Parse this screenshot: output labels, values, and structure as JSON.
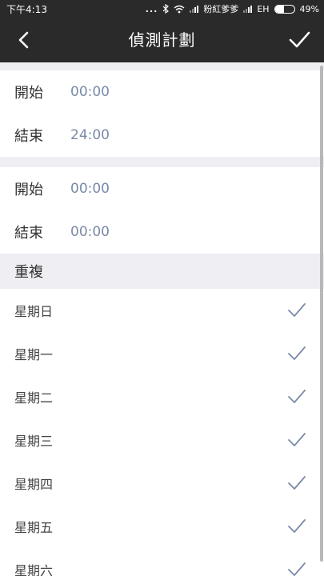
{
  "status_bar": {
    "time": "下午4:13",
    "dots": "...",
    "carrier": "粉紅爹爹",
    "network": "EH",
    "battery": "49%",
    "battery_level": 0.49
  },
  "nav": {
    "title": "偵測計劃",
    "back_icon": "chevron-left-icon",
    "confirm_icon": "check-icon"
  },
  "schedules": [
    {
      "start_label": "開始",
      "start_value": "00:00",
      "end_label": "結束",
      "end_value": "24:00"
    },
    {
      "start_label": "開始",
      "start_value": "00:00",
      "end_label": "結束",
      "end_value": "00:00"
    }
  ],
  "repeat": {
    "header": "重複",
    "days": [
      {
        "label": "星期日",
        "checked": true
      },
      {
        "label": "星期一",
        "checked": true
      },
      {
        "label": "星期二",
        "checked": true
      },
      {
        "label": "星期三",
        "checked": true
      },
      {
        "label": "星期四",
        "checked": true
      },
      {
        "label": "星期五",
        "checked": true
      },
      {
        "label": "星期六",
        "checked": true
      }
    ]
  },
  "colors": {
    "bar": "#2a2a2a",
    "value_text": "#7a8aa8",
    "check": "#7a8aa8",
    "section_bg": "#efeff3"
  }
}
